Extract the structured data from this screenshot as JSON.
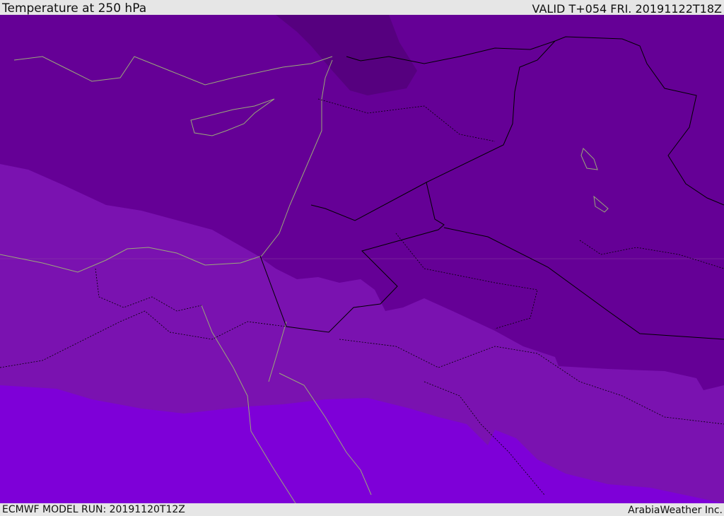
{
  "header": {
    "title": "Temperature at 250 hPa",
    "valid": "VALID T+054 FRI. 20191122T18Z"
  },
  "footer": {
    "model_run": "ECMWF MODEL RUN: 20191120T12Z",
    "brand": "ArabiaWeather Inc."
  },
  "colors": {
    "coldest": "#56007f",
    "cold": "#650096",
    "mid": "#7a12b0",
    "warm": "#7e00d8",
    "coast": "#9aa87a",
    "border": "#000000"
  }
}
